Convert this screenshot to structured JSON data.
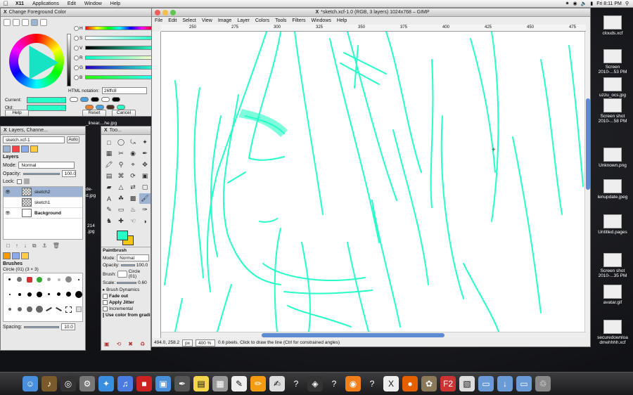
{
  "menubar": {
    "app": "X11",
    "items": [
      "Applications",
      "Edit",
      "Window",
      "Help"
    ],
    "clock": "Fri 8:11 PM"
  },
  "color_dialog": {
    "title": "Change Foreground Color",
    "sliders": [
      {
        "label": "H",
        "value": "165",
        "grad": "linear-gradient(90deg,red,yellow,lime,cyan,blue,magenta,red)"
      },
      {
        "label": "S",
        "value": "85",
        "grad": "linear-gradient(90deg,#fff,#26ffc8)"
      },
      {
        "label": "V",
        "value": "100",
        "grad": "linear-gradient(90deg,#000,#26ffc8)"
      },
      {
        "label": "R",
        "value": "38",
        "grad": "linear-gradient(90deg,#00ffc8,#ffffc8)"
      },
      {
        "label": "G",
        "value": "255",
        "grad": "linear-gradient(90deg,#2600c8,#26ffc8)"
      },
      {
        "label": "B",
        "value": "200",
        "grad": "linear-gradient(90deg,#26ff00,#26ffff)"
      }
    ],
    "html_label": "HTML notation:",
    "html_value": "26ffc8",
    "current_label": "Current:",
    "old_label": "Old:",
    "current_color": "#26ffc8",
    "help_label": "Help",
    "reset_label": "Reset",
    "cancel_label": "Cancel"
  },
  "layers_panel": {
    "title": "Layers, Channe...",
    "image_select": "sketch.xcf-1",
    "auto_label": "Auto",
    "section": "Layers",
    "mode_label": "Mode:",
    "mode_value": "Normal",
    "opacity_label": "Opacity:",
    "opacity_value": "100.0",
    "lock_label": "Lock:",
    "layers": [
      {
        "name": "sketch2",
        "selected": true
      },
      {
        "name": "sketch1",
        "selected": false
      },
      {
        "name": "Background",
        "selected": false
      }
    ],
    "brushes_section": "Brushes",
    "brush_name": "Circle (01) (3 × 3)",
    "spacing_label": "Spacing:",
    "spacing_value": "10.0"
  },
  "toolbox": {
    "title": "Too...",
    "options_title": "Paintbrush",
    "mode_label": "Mode:",
    "mode_value": "Normal",
    "opacity_label": "Opacity:",
    "opacity_value": "100.0",
    "brush_label": "Brush:",
    "brush_value": "Circle (01)",
    "scale_label": "Scale:",
    "scale_value": "0.60",
    "brush_dynamics": "Brush Dynamics",
    "fade_out": "Fade out",
    "apply_jitter": "Apply Jitter",
    "incremental": "Incremental",
    "use_color": "Use color from gradie"
  },
  "gimp": {
    "title": "*sketch.xcf-1.0 (RGB, 3 layers) 1024x768 – GIMP",
    "menu": [
      "File",
      "Edit",
      "Select",
      "View",
      "Image",
      "Layer",
      "Colors",
      "Tools",
      "Filters",
      "Windows",
      "Help"
    ],
    "ruler_ticks": [
      "250",
      "275",
      "300",
      "325",
      "350",
      "375",
      "400",
      "425",
      "450",
      "475"
    ],
    "coords": "494.0, 258.2",
    "unit": "px",
    "zoom": "400 %",
    "status": "0.6 pixels.  Click to draw the line (Ctrl for constrained angles)"
  },
  "desktop_icons": [
    {
      "label": "clouds.xcf"
    },
    {
      "label": "Screen\n2010-...53 PM"
    },
    {
      "label": "uzzu_ocs.jpg"
    },
    {
      "label": "Screen shot\n2010-...58 PM"
    },
    {
      "label": "Unknown.png"
    },
    {
      "label": "lenupdate.jpeg"
    },
    {
      "label": "Untitled.pages"
    },
    {
      "label": "Screen shot\n2010-...35 PM"
    },
    {
      "label": "avatar.gif"
    },
    {
      "label": "securedownloa\ndmehhhh.xcf"
    }
  ],
  "left_desktop_labels": [
    "_linear....he.jpg",
    "de-",
    "d.jpg",
    "214",
    ".jpg"
  ],
  "dock_icons": [
    "finder",
    "garageband",
    "dashboard",
    "system-prefs",
    "safari",
    "itunes",
    "photobooth",
    "iphoto",
    "pen",
    "stickies",
    "calculator",
    "script",
    "pencil",
    "textedit",
    "unknown-app",
    "unity",
    "unknown-app",
    "blender",
    "unknown-app",
    "x11",
    "firefox",
    "gimp",
    "f2",
    "preview",
    "folder",
    "downloads",
    "folder",
    "trash"
  ],
  "colors": {
    "accent": "#26ffc8",
    "selection": "#9cb3d3",
    "scroll": "#5d8ad2"
  }
}
